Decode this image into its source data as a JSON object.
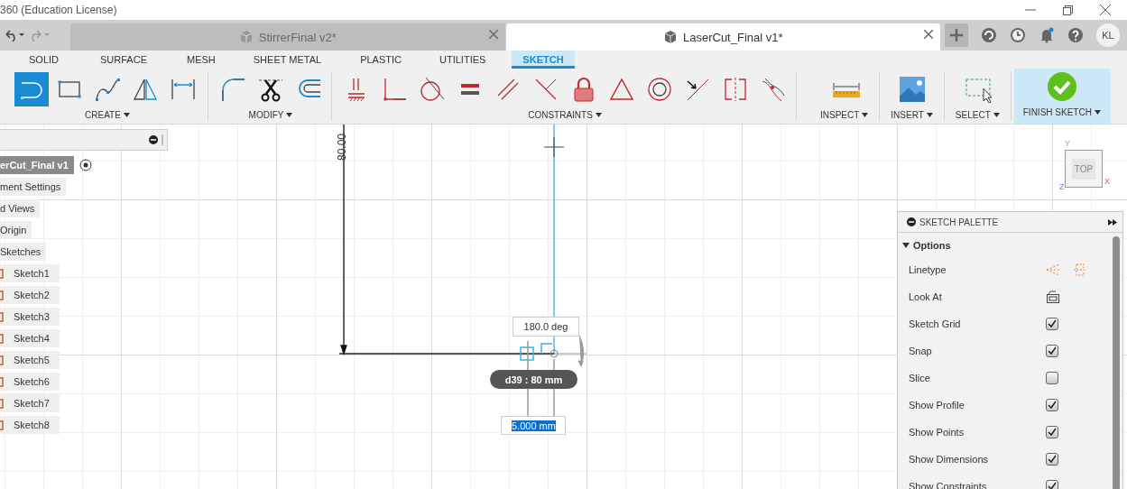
{
  "window": {
    "title": "360 (Education License)"
  },
  "document_tabs": [
    {
      "label": "StirrerFinal v2*",
      "selected": false
    },
    {
      "label": "LaserCut_Final v1*",
      "selected": true
    }
  ],
  "account": {
    "initials": "KL"
  },
  "ribbon": {
    "tabs": [
      {
        "label": "SOLID",
        "selected": false
      },
      {
        "label": "SURFACE",
        "selected": false
      },
      {
        "label": "MESH",
        "selected": false
      },
      {
        "label": "SHEET METAL",
        "selected": false
      },
      {
        "label": "PLASTIC",
        "selected": false
      },
      {
        "label": "UTILITIES",
        "selected": false
      },
      {
        "label": "SKETCH",
        "selected": true
      }
    ],
    "groups": [
      {
        "label": "CREATE",
        "kind": "tools",
        "tools": [
          {
            "kind": "line",
            "selected": true
          },
          {
            "kind": "rectangle",
            "selected": false
          },
          {
            "kind": "spline",
            "selected": false
          },
          {
            "kind": "mirror",
            "selected": false
          },
          {
            "kind": "dimension",
            "selected": false
          }
        ]
      },
      {
        "label": "MODIFY",
        "kind": "tools",
        "tools": [
          {
            "kind": "fillet",
            "selected": false
          },
          {
            "kind": "trim",
            "selected": false
          },
          {
            "kind": "offset",
            "selected": false
          }
        ]
      },
      {
        "label": "CONSTRAINTS",
        "kind": "tools",
        "tools": [
          {
            "kind": "fix-ground",
            "selected": false
          },
          {
            "kind": "coincident",
            "selected": false
          },
          {
            "kind": "tangent",
            "selected": false
          },
          {
            "kind": "equal",
            "selected": false
          },
          {
            "kind": "parallel",
            "selected": false
          },
          {
            "kind": "perpendicular",
            "selected": false
          },
          {
            "kind": "lock",
            "selected": false
          },
          {
            "kind": "triangle",
            "selected": false
          },
          {
            "kind": "concentric",
            "selected": false
          },
          {
            "kind": "collinear",
            "selected": false
          },
          {
            "kind": "symmetry",
            "selected": false
          },
          {
            "kind": "curvature",
            "selected": false
          }
        ]
      },
      {
        "label": "INSPECT",
        "kind": "tools",
        "tools": [
          {
            "kind": "measure",
            "selected": false
          }
        ]
      },
      {
        "label": "INSERT",
        "kind": "tools",
        "tools": [
          {
            "kind": "image",
            "selected": false
          }
        ]
      },
      {
        "label": "SELECT",
        "kind": "tools",
        "tools": [
          {
            "kind": "select",
            "selected": false
          }
        ]
      },
      {
        "label": "FINISH SKETCH",
        "kind": "finish",
        "tools": [
          {
            "kind": "finish",
            "selected": false
          }
        ]
      }
    ]
  },
  "browser": {
    "root": {
      "label": "erCut_Final v1",
      "selected": true
    },
    "items": [
      {
        "label": "ment Settings"
      },
      {
        "label": "d Views"
      },
      {
        "label": "Origin"
      },
      {
        "label": "Sketches",
        "children": [
          {
            "label": "Sketch1"
          },
          {
            "label": "Sketch2"
          },
          {
            "label": "Sketch3"
          },
          {
            "label": "Sketch4"
          },
          {
            "label": "Sketch5"
          },
          {
            "label": "Sketch6"
          },
          {
            "label": "Sketch7"
          },
          {
            "label": "Sketch8"
          }
        ]
      }
    ]
  },
  "canvas": {
    "dimension_label": "80.00",
    "angle_input": "180.0 deg",
    "dimension_tooltip": "d39 : 80 mm",
    "length_input": {
      "value": "5.000 mm",
      "value_selected": true
    },
    "view_cube": {
      "face": "TOP",
      "axis_y": "Y",
      "axis_x": "X",
      "axis_z": "Z"
    }
  },
  "sketch_palette": {
    "title": "SKETCH PALETTE",
    "section": {
      "label": "Options",
      "expanded": true,
      "rows": [
        {
          "label": "Linetype",
          "kind": "icons"
        },
        {
          "label": "Look At",
          "kind": "button"
        },
        {
          "label": "Sketch Grid",
          "kind": "checkbox",
          "checked": true
        },
        {
          "label": "Snap",
          "kind": "checkbox",
          "checked": true
        },
        {
          "label": "Slice",
          "kind": "checkbox",
          "checked": false
        },
        {
          "label": "Show Profile",
          "kind": "checkbox",
          "checked": true
        },
        {
          "label": "Show Points",
          "kind": "checkbox",
          "checked": true
        },
        {
          "label": "Show Dimensions",
          "kind": "checkbox",
          "checked": true
        },
        {
          "label": "Show Constraints",
          "kind": "checkbox",
          "checked": true
        }
      ]
    }
  }
}
